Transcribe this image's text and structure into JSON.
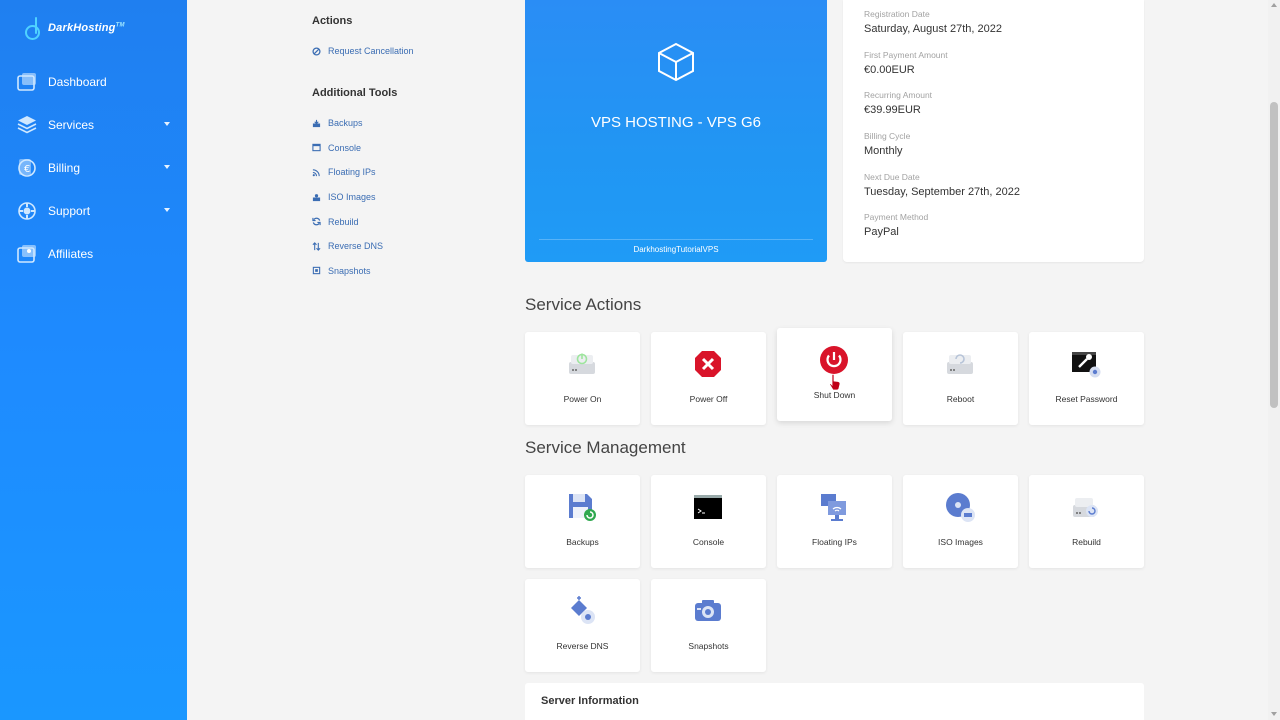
{
  "brand": {
    "name": "DarkHosting",
    "tm": "TM"
  },
  "sidebar": {
    "items": [
      {
        "label": "Dashboard",
        "icon": "dashboard-icon",
        "has_caret": false
      },
      {
        "label": "Services",
        "icon": "services-icon",
        "has_caret": true
      },
      {
        "label": "Billing",
        "icon": "billing-icon",
        "has_caret": true
      },
      {
        "label": "Support",
        "icon": "support-icon",
        "has_caret": true
      },
      {
        "label": "Affiliates",
        "icon": "affiliates-icon",
        "has_caret": false
      }
    ]
  },
  "actions": {
    "title": "Actions",
    "items": [
      {
        "label": "Request Cancellation",
        "icon": "ban-icon"
      }
    ]
  },
  "additional_tools": {
    "title": "Additional Tools",
    "items": [
      {
        "label": "Backups",
        "icon": "backups-icon"
      },
      {
        "label": "Console",
        "icon": "console-icon"
      },
      {
        "label": "Floating IPs",
        "icon": "floating-ips-icon"
      },
      {
        "label": "ISO Images",
        "icon": "iso-images-icon"
      },
      {
        "label": "Rebuild",
        "icon": "rebuild-icon"
      },
      {
        "label": "Reverse DNS",
        "icon": "reverse-dns-icon"
      },
      {
        "label": "Snapshots",
        "icon": "snapshots-icon"
      }
    ]
  },
  "product": {
    "name": "VPS HOSTING - VPS G6",
    "domain": "DarkhostingTutorialVPS",
    "icon": "cube-icon"
  },
  "billing_info": {
    "registration_date": {
      "label": "Registration Date",
      "value": "Saturday, August 27th, 2022"
    },
    "first_payment": {
      "label": "First Payment Amount",
      "value": "€0.00EUR"
    },
    "recurring": {
      "label": "Recurring Amount",
      "value": "€39.99EUR"
    },
    "billing_cycle": {
      "label": "Billing Cycle",
      "value": "Monthly"
    },
    "next_due": {
      "label": "Next Due Date",
      "value": "Tuesday, September 27th, 2022"
    },
    "payment_method": {
      "label": "Payment Method",
      "value": "PayPal"
    }
  },
  "service_actions": {
    "title": "Service Actions",
    "items": [
      {
        "label": "Power On",
        "icon": "power-on-icon"
      },
      {
        "label": "Power Off",
        "icon": "power-off-icon"
      },
      {
        "label": "Shut Down",
        "icon": "shut-down-icon"
      },
      {
        "label": "Reboot",
        "icon": "reboot-icon"
      },
      {
        "label": "Reset Password",
        "icon": "reset-password-icon"
      }
    ]
  },
  "service_management": {
    "title": "Service Management",
    "items": [
      {
        "label": "Backups",
        "icon": "backups-icon"
      },
      {
        "label": "Console",
        "icon": "console-icon"
      },
      {
        "label": "Floating IPs",
        "icon": "floating-ips-icon"
      },
      {
        "label": "ISO Images",
        "icon": "iso-images-icon"
      },
      {
        "label": "Rebuild",
        "icon": "rebuild-icon"
      },
      {
        "label": "Reverse DNS",
        "icon": "reverse-dns-icon"
      },
      {
        "label": "Snapshots",
        "icon": "snapshots-icon"
      }
    ]
  },
  "server_info": {
    "title": "Server Information"
  },
  "colors": {
    "sidebar": "#1e8bff",
    "link": "#3b6db3",
    "product_card": "#2196f3",
    "danger": "#d9142a"
  }
}
